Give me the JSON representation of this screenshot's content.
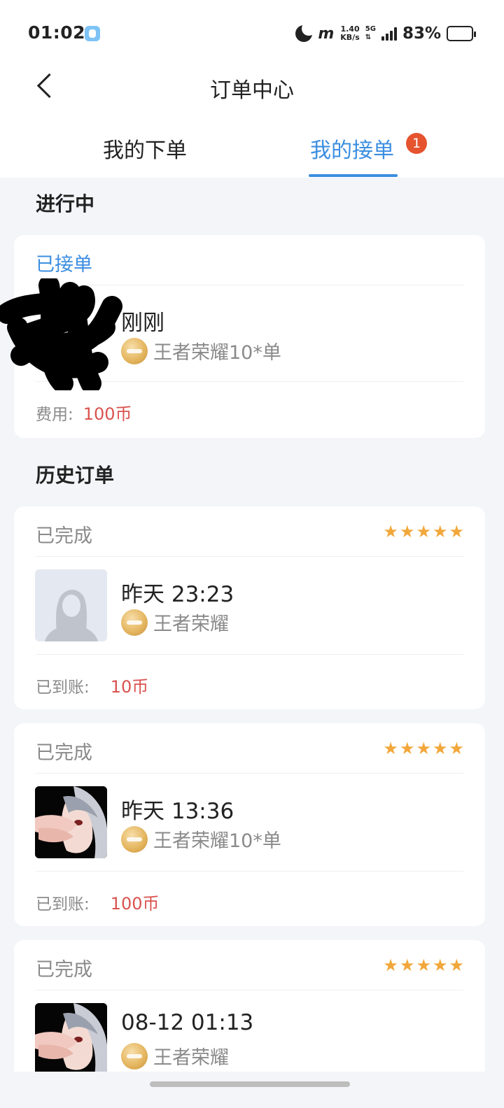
{
  "status_bar": {
    "time": "01:02",
    "speed_value": "1.40",
    "speed_unit": "KB/s",
    "network": "5G",
    "battery": "83%",
    "battery_level": 0.83
  },
  "header": {
    "title": "订单中心",
    "tabs": [
      {
        "label": "我的下单",
        "active": false
      },
      {
        "label": "我的接单",
        "active": true,
        "badge": "1"
      }
    ]
  },
  "in_progress": {
    "section_title": "进行中",
    "order": {
      "status": "已接单",
      "time": "刚刚",
      "game": "王者荣耀10*单",
      "fee_label": "费用:",
      "fee_value": "100币"
    }
  },
  "history": {
    "section_title": "历史订单",
    "orders": [
      {
        "status": "已完成",
        "rating": 5,
        "time": "昨天 23:23",
        "game": "王者荣耀",
        "amount_label": "已到账:",
        "amount_value": "10币",
        "avatar": "default-avatar"
      },
      {
        "status": "已完成",
        "rating": 5,
        "time": "昨天 13:36",
        "game": "王者荣耀10*单",
        "amount_label": "已到账:",
        "amount_value": "100币",
        "avatar": "anime-avatar"
      },
      {
        "status": "已完成",
        "rating": 5,
        "time": "08-12 01:13",
        "game": "王者荣耀",
        "avatar": "anime-avatar"
      }
    ]
  },
  "colors": {
    "accent": "#3b8ee0",
    "badge": "#e5532f",
    "price": "#d9534f",
    "star": "#f2a73b",
    "background": "#f3f5f9"
  }
}
